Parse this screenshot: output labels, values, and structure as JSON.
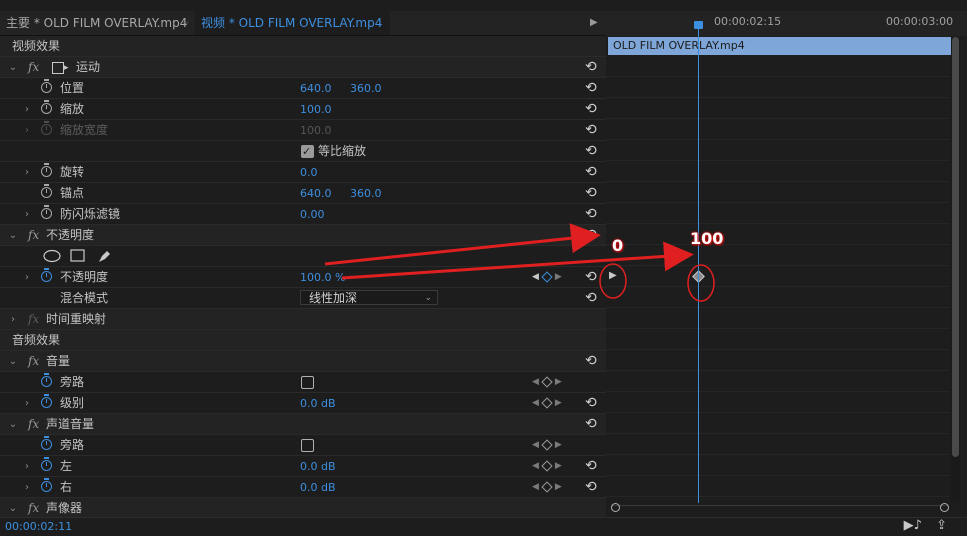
{
  "tabs": {
    "main": "主要 * OLD FILM OVERLAY.mp4",
    "video": "视频 * OLD FILM OVERLAY.mp4"
  },
  "sections": {
    "video_effects": "视频效果",
    "audio_effects": "音频效果"
  },
  "motion": {
    "name": "运动",
    "position": {
      "label": "位置",
      "x": "640.0",
      "y": "360.0"
    },
    "scale": {
      "label": "缩放",
      "value": "100.0"
    },
    "scale_width": {
      "label": "缩放宽度",
      "value": "100.0"
    },
    "uniform_scale": {
      "label": "等比缩放",
      "checked": true
    },
    "rotation": {
      "label": "旋转",
      "value": "0.0"
    },
    "anchor": {
      "label": "锚点",
      "x": "640.0",
      "y": "360.0"
    },
    "antiflicker": {
      "label": "防闪烁滤镜",
      "value": "0.00"
    }
  },
  "opacity": {
    "name": "不透明度",
    "value_label": "不透明度",
    "value": "100.0 %",
    "blend_label": "混合模式",
    "blend_value": "线性加深"
  },
  "time_remap": "时间重映射",
  "volume": {
    "name": "音量",
    "bypass": "旁路",
    "level_label": "级别",
    "level_value": "0.0 dB"
  },
  "channel_volume": {
    "name": "声道音量",
    "bypass": "旁路",
    "left_label": "左",
    "left_value": "0.0 dB",
    "right_label": "右",
    "right_value": "0.0 dB"
  },
  "panner": "声像器",
  "timeline": {
    "tc1": "00:00:02:15",
    "tc2": "00:00:03:00",
    "clip": "OLD FILM OVERLAY.mp4"
  },
  "current_time": "00:00:02:11",
  "annotations": {
    "label_zero": "0",
    "label_hundred": "100",
    "color": "#e02020"
  },
  "colors": {
    "accent": "#3d8fe0",
    "clip": "#7fa6d8"
  }
}
